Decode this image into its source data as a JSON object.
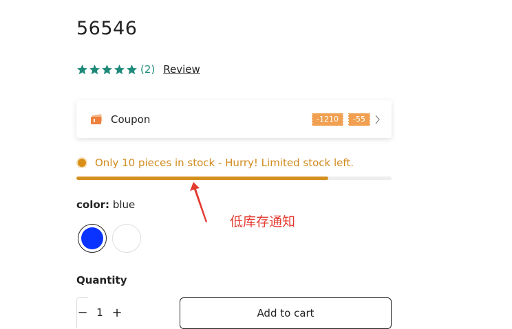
{
  "product": {
    "title": "56546",
    "rating": {
      "stars": 5,
      "count_text": "(2)",
      "review_link": "Review",
      "star_color": "#1e8a7a"
    },
    "coupon": {
      "label": "Coupon",
      "tags": [
        "-1210",
        "-55"
      ],
      "accent": "#f0a050"
    },
    "stock": {
      "message": "Only 10 pieces in stock - Hurry! Limited stock left.",
      "level": 0.8,
      "color": "#d4901f"
    },
    "annotation": "低库存通知",
    "color": {
      "label": "color:",
      "value": "blue",
      "swatches": [
        {
          "name": "blue",
          "hex": "#0a33ff",
          "selected": true
        },
        {
          "name": "white",
          "hex": "#ffffff",
          "selected": false
        }
      ]
    },
    "quantity": {
      "label": "Quantity",
      "minus": "−",
      "value": "1",
      "plus": "+"
    },
    "add_to_cart": "Add to cart"
  }
}
